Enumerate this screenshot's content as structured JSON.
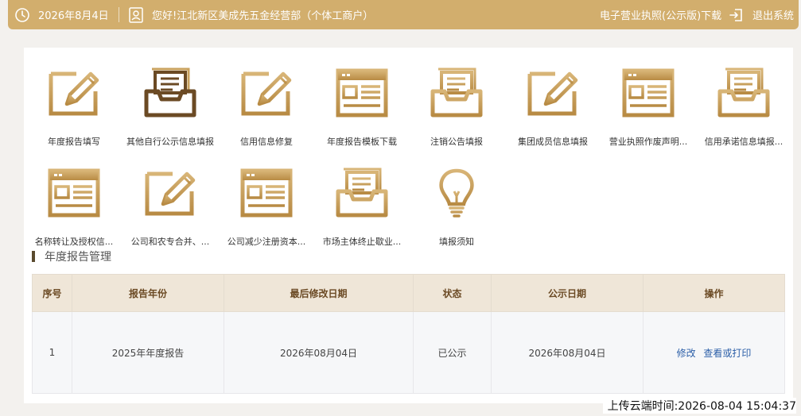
{
  "topbar": {
    "date": "2026年8月4日",
    "greeting": "您好!江北新区美成先五金经营部（个体工商户）",
    "license_download": "电子营业执照(公示版)下载",
    "logout": "退出系统"
  },
  "tiles": [
    {
      "label": "年度报告填写",
      "icon": "pencil-doc-icon"
    },
    {
      "label": "其他自行公示信息填报",
      "icon": "inbox-tray-icon"
    },
    {
      "label": "信用信息修复",
      "icon": "pencil-doc-icon"
    },
    {
      "label": "年度报告模板下载",
      "icon": "form-template-icon"
    },
    {
      "label": "注销公告填报",
      "icon": "inbox-tray-icon"
    },
    {
      "label": "集团成员信息填报",
      "icon": "pencil-doc-icon"
    },
    {
      "label": "营业执照作废声明...",
      "icon": "form-template-icon"
    },
    {
      "label": "信用承诺信息填报...",
      "icon": "inbox-tray-icon"
    },
    {
      "label": "名称转让及授权信...",
      "icon": "form-template-icon"
    },
    {
      "label": "公司和农专合并、...",
      "icon": "pencil-doc-icon"
    },
    {
      "label": "公司减少注册资本...",
      "icon": "form-template-icon"
    },
    {
      "label": "市场主体终止歇业...",
      "icon": "inbox-tray-icon"
    },
    {
      "label": "填报须知",
      "icon": "lightbulb-icon"
    }
  ],
  "section": {
    "title": "年度报告管理"
  },
  "table": {
    "headers": [
      "序号",
      "报告年份",
      "最后修改日期",
      "状态",
      "公示日期",
      "操作"
    ],
    "rows": [
      {
        "index": "1",
        "year": "2025年年度报告",
        "modified": "2026年08月04日",
        "status": "已公示",
        "publish_date": "2026年08月04日",
        "edit": "修改",
        "view_print": "查看或打印"
      }
    ]
  },
  "footer": {
    "upload_time": "上传云端时间:2026-08-04 15:04:37"
  },
  "colors": {
    "brand": "#d2ae6d",
    "icon_gold": "#c9a25e",
    "icon_dark": "#6b4a24",
    "header_bg": "#efe6d8",
    "link": "#2c5fa8"
  }
}
